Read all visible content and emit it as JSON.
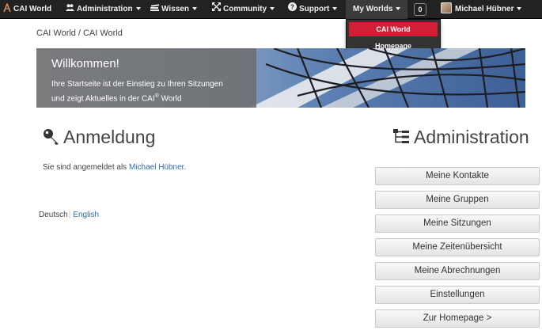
{
  "navbar": {
    "brand": "CAI World",
    "administration": "Administration",
    "wissen": "Wissen",
    "community": "Community",
    "support": "Support",
    "my_worlds": "My Worlds",
    "notification_count": "0",
    "user_name": "Michael Hübner"
  },
  "my_worlds_menu": {
    "items": [
      "CAI World",
      "Homepage"
    ],
    "active_index": 0,
    "active_color": "#d21f35"
  },
  "breadcrumb": {
    "first": "CAI World",
    "separator": "/",
    "second": "CAI World"
  },
  "banner": {
    "title": "Willkommen!",
    "subtitle_line1": "Ihre Startseite ist der Einstieg zu Ihren Sitzungen",
    "subtitle_line2_prefix": "und zeigt Aktuelles in der CAI",
    "subtitle_superscript": "®",
    "subtitle_line2_suffix": " World"
  },
  "login": {
    "heading": "Anmeldung",
    "text_prefix": "Sie sind angemeldet als ",
    "user_link": "Michael  Hübner",
    "text_suffix": "."
  },
  "language": {
    "current": "Deutsch",
    "separator": "|",
    "other": "English"
  },
  "administration": {
    "heading": "Administration",
    "buttons": [
      "Meine Kontakte",
      "Meine Gruppen",
      "Meine Sitzungen",
      "Meine Zeitenübersicht",
      "Meine Abrechnungen",
      "Einstellungen",
      "Zur Homepage >"
    ]
  },
  "colors": {
    "navbar_bg": "#222222",
    "link": "#2e6da4",
    "accent": "#d21f35"
  }
}
